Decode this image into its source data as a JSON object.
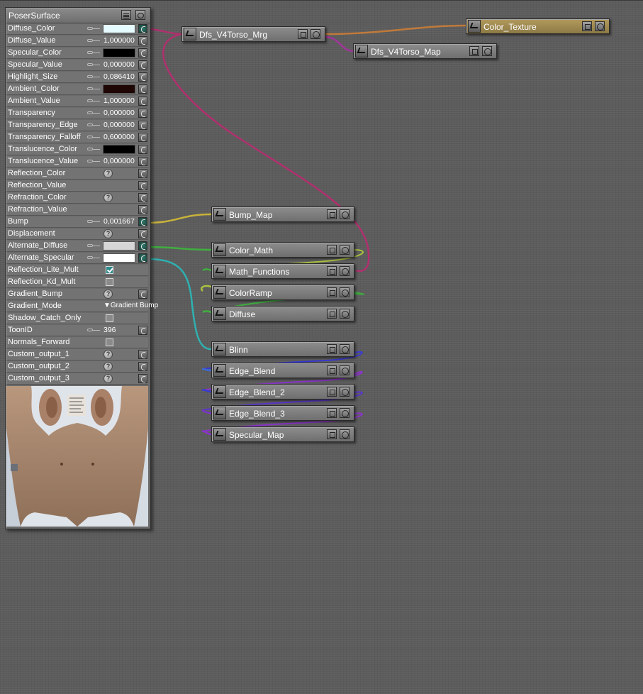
{
  "root": {
    "title": "PoserSurface",
    "rows": [
      {
        "label": "Diffuse_Color",
        "kind": "color",
        "color": "#e6fbff",
        "keyed": true,
        "connected": true
      },
      {
        "label": "Diffuse_Value",
        "kind": "value",
        "value": "1,000000",
        "keyed": true
      },
      {
        "label": "Specular_Color",
        "kind": "color",
        "color": "#000000",
        "keyed": true
      },
      {
        "label": "Specular_Value",
        "kind": "value",
        "value": "0,000000",
        "keyed": true
      },
      {
        "label": "Highlight_Size",
        "kind": "value",
        "value": "0,086410",
        "keyed": true
      },
      {
        "label": "Ambient_Color",
        "kind": "color",
        "color": "#1e0604",
        "keyed": true
      },
      {
        "label": "Ambient_Value",
        "kind": "value",
        "value": "1,000000",
        "keyed": true
      },
      {
        "label": "Transparency",
        "kind": "value",
        "value": "0,000000",
        "keyed": true
      },
      {
        "label": "Transparency_Edge",
        "kind": "value",
        "value": "0,000000",
        "keyed": true
      },
      {
        "label": "Transparency_Falloff",
        "kind": "value",
        "value": "0,600000",
        "keyed": true
      },
      {
        "label": "Translucence_Color",
        "kind": "color",
        "color": "#000000",
        "keyed": true
      },
      {
        "label": "Translucence_Value",
        "kind": "value",
        "value": "0,000000",
        "keyed": true
      },
      {
        "label": "Reflection_Color",
        "kind": "help"
      },
      {
        "label": "Reflection_Value",
        "kind": "none"
      },
      {
        "label": "Refraction_Color",
        "kind": "help"
      },
      {
        "label": "Refraction_Value",
        "kind": "none"
      },
      {
        "label": "Bump",
        "kind": "value",
        "value": "0,001667",
        "keyed": true,
        "connected": true
      },
      {
        "label": "Displacement",
        "kind": "help"
      },
      {
        "label": "Alternate_Diffuse",
        "kind": "color",
        "color": "#d6d6d6",
        "keyed": true,
        "connected": true
      },
      {
        "label": "Alternate_Specular",
        "kind": "color",
        "color": "#ffffff",
        "keyed": true,
        "connected": true
      },
      {
        "label": "Reflection_Lite_Mult",
        "kind": "check",
        "checked": true
      },
      {
        "label": "Reflection_Kd_Mult",
        "kind": "check",
        "checked": false
      },
      {
        "label": "Gradient_Bump",
        "kind": "help"
      },
      {
        "label": "Gradient_Mode",
        "kind": "dropdown",
        "value": "▼Gradient Bump"
      },
      {
        "label": "Shadow_Catch_Only",
        "kind": "check",
        "checked": false
      },
      {
        "label": "ToonID",
        "kind": "value",
        "value": "396",
        "keyed": true
      },
      {
        "label": "Normals_Forward",
        "kind": "check",
        "checked": false
      },
      {
        "label": "Custom_output_1",
        "kind": "help"
      },
      {
        "label": "Custom_output_2",
        "kind": "help"
      },
      {
        "label": "Custom_output_3",
        "kind": "help"
      }
    ],
    "preview_text": "Body texture preview"
  },
  "nodes": [
    {
      "id": "dfs_v4torso_mrg",
      "title": "Dfs_V4Torso_Mrg"
    },
    {
      "id": "dfs_v4torso_map",
      "title": "Dfs_V4Torso_Map"
    },
    {
      "id": "color_texture",
      "title": "Color_Texture"
    },
    {
      "id": "bump_map",
      "title": "Bump_Map"
    },
    {
      "id": "color_math",
      "title": "Color_Math"
    },
    {
      "id": "math_functions",
      "title": "Math_Functions"
    },
    {
      "id": "colorramp",
      "title": "ColorRamp"
    },
    {
      "id": "diffuse",
      "title": "Diffuse"
    },
    {
      "id": "blinn",
      "title": "Blinn"
    },
    {
      "id": "edge_blend",
      "title": "Edge_Blend"
    },
    {
      "id": "edge_blend_2",
      "title": "Edge_Blend_2"
    },
    {
      "id": "edge_blend_3",
      "title": "Edge_Blend_3"
    },
    {
      "id": "specular_map",
      "title": "Specular_Map"
    }
  ],
  "colors": {
    "canvas": "#5c5c5c",
    "wire_magenta": "#b0306e",
    "wire_orange": "#c07a3a",
    "wire_yellow": "#c8b23a",
    "wire_green": "#3fae3f",
    "wire_cyan": "#2fb0b0",
    "wire_blue": "#3a3ad0",
    "wire_purple": "#8a34c8"
  }
}
